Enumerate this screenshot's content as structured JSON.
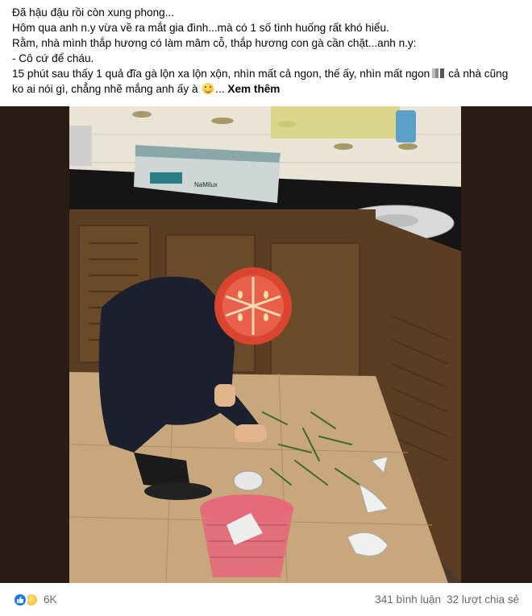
{
  "post": {
    "lines": [
      "Đã hậu đậu rồi còn xung phong...",
      "Hôm qua anh n.y vừa về ra mắt gia đình...mà có 1 số tình huống rất khó hiểu.",
      "Rằm, nhà mình thắp hương có làm mâm cỗ, thắp hương con gà cần chặt...anh n.y:",
      "- Cô cứ để cháu.",
      "15 phút sau thấy 1 quả đĩa gà lộn xa lộn xộn, nhìn mất cả ngon, thế ấy, nhìn mất ngon",
      "cả nhà cũng ko ai nói gì, chẳng nhẽ mắng anh ấy à",
      "..."
    ],
    "see_more": "Xem thêm"
  },
  "photo": {
    "stove_brand": "NaMilux"
  },
  "footer": {
    "reaction_icons": [
      "like-icon",
      "haha-icon"
    ],
    "reaction_count": "6K",
    "comments": "341 bình luận",
    "shares": "32 lượt chia sẻ"
  },
  "colors": {
    "link_blue": "#1877f2",
    "secondary_text": "#65676b",
    "emoji_mask": "#d9452e"
  }
}
